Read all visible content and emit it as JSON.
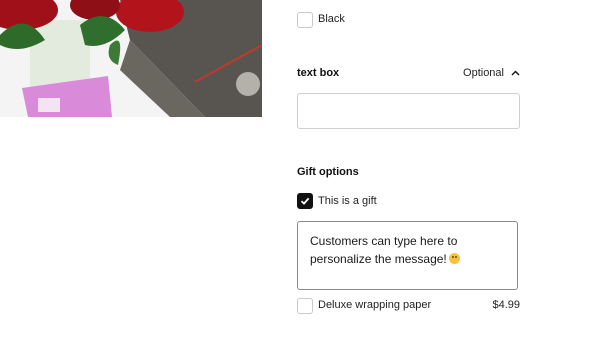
{
  "color_options": {
    "black_label": "Black",
    "black_checked": false
  },
  "text_box": {
    "title": "text box",
    "optional_label": "Optional",
    "value": ""
  },
  "gift_options": {
    "title": "Gift options",
    "is_gift_label": "This is a gift",
    "is_gift_checked": true,
    "message": "Customers can type here to personalize the message!",
    "message_emoji": "smiling-face-icon",
    "wrapping_label": "Deluxe wrapping paper",
    "wrapping_checked": false,
    "wrapping_price": "$4.99"
  },
  "colors": {
    "checked_fill": "#111111",
    "border": "#cfcfcf",
    "rose_red": "#b01018"
  }
}
